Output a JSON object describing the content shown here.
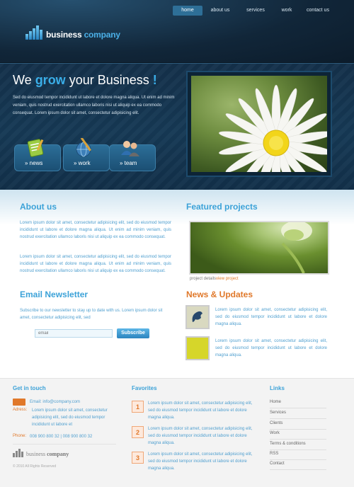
{
  "nav": {
    "items": [
      {
        "label": "home",
        "active": true
      },
      {
        "label": "about us",
        "active": false
      },
      {
        "label": "services",
        "active": false
      },
      {
        "label": "work",
        "active": false
      },
      {
        "label": "contact us",
        "active": false
      }
    ]
  },
  "logo": {
    "word1": "business",
    "word2": "company"
  },
  "hero": {
    "title_pre": "We ",
    "title_grow": "grow",
    "title_post": " your Business ",
    "title_bang": "!",
    "text": "Sed do eiusmod tempor incididunt ut labore et dolore magna aliqua. Ut enim ad minim veniam, quis nostrud exercitation ullamco laboris nisi ut aliquip ex ea commodo consequat. Lorem ipsum dolor sit amet, consectetur adipisicing elit.",
    "buttons": [
      {
        "label": "» news",
        "icon": "notepad-icon"
      },
      {
        "label": "» work",
        "icon": "globe-pencil-icon"
      },
      {
        "label": "» team",
        "icon": "people-icon"
      }
    ]
  },
  "about": {
    "title": "About us",
    "p1": "Lorem ipsum dolor sit amet, consectetur adipisicing elit, sed do eiusmod tempor incididunt ut labore et dolore magna aliqua. Ut enim ad minim veniam, quis nostrud exercitation ullamco laboris nisi ut aliquip ex ea commodo consequat.",
    "p2": "Lorem ipsum dolor sit amet, consectetur adipisicing elit, sed do eiusmod tempor incididunt ut labore et dolore magna aliqua. Ut enim ad minim veniam, quis nostrud exercitation ullamco laboris nisi ut aliquip ex ea commodo consequat."
  },
  "featured": {
    "title": "Featured projects",
    "caption": "project details",
    "link": "view project"
  },
  "newsletter": {
    "title": "Email Newsletter",
    "text": "Subscribe to our newsletter to stay up to date with us. Lorem ipsum dolor sit amet, consectetur adipisicing elit, sed",
    "placeholder": "email",
    "button": "Subscribe"
  },
  "news": {
    "title": "News & Updates",
    "items": [
      {
        "text": "Lorem ipsum dolor sit amet, consectetur adipisicing elit, sed do eiusmod tempor incididunt ut labore et dolore magna aliqua.",
        "thumb_color": "#d9d9c0"
      },
      {
        "text": "Lorem ipsum dolor sit amet, consectetur adipisicing elit, sed do eiusmod tempor incididunt ut labore et dolore magna aliqua.",
        "thumb_color": "#d6d62a"
      }
    ]
  },
  "footer": {
    "contact": {
      "title": "Get in touch",
      "email": "Email: info@company.com",
      "address_label": "Adress:",
      "address": "Lorem ipsum dolor sit amet, consectetur adipisicing elit, sed do eiusmod tempor incididunt ut labore et",
      "phone_label": "Phone:",
      "phone": "008 900 800 32 | 008 900 800 32"
    },
    "logo": {
      "word1": "business",
      "word2": "company"
    },
    "copyright": "© 2010 All Rights Reserved",
    "favorites": {
      "title": "Favorites",
      "items": [
        {
          "num": "1",
          "text": "Lorem ipsum dolor sit amet, consectetur adipisicing elit, sed do eiusmod tempor incididunt ut labore et dolore magna aliqua."
        },
        {
          "num": "2",
          "text": "Lorem ipsum dolor sit amet, consectetur adipisicing elit, sed do eiusmod tempor incididunt ut labore et dolore magna aliqua."
        },
        {
          "num": "3",
          "text": "Lorem ipsum dolor sit amet, consectetur adipisicing elit, sed do eiusmod tempor incididunt ut labore et dolore magna aliqua."
        }
      ]
    },
    "links": {
      "title": "Links",
      "items": [
        "Home",
        "Services",
        "Clients",
        "Work",
        "Terms & conditions",
        "RSS",
        "Contact"
      ]
    }
  },
  "colors": {
    "accent_blue": "#3ca2d8",
    "accent_orange": "#e0782a",
    "header_dark": "#14304a"
  }
}
